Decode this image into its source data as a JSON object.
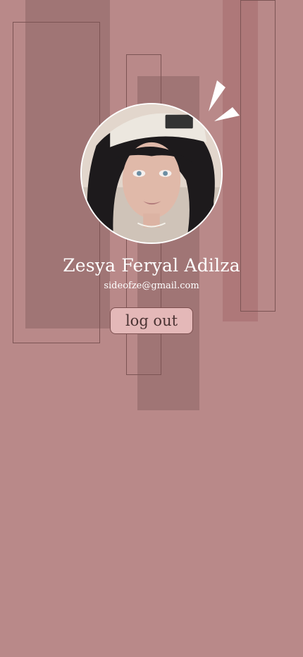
{
  "profile": {
    "name": "Zesya Feryal Adilza",
    "email": "sideofze@gmail.com"
  },
  "actions": {
    "logout_label": "log out"
  },
  "theme": {
    "background": "#b98989",
    "button_bg": "#e4b8b8",
    "text_color": "#ffffff"
  },
  "icons": {
    "avatar": "profile-photo-avatar",
    "sparkle": "sparkle-icon"
  }
}
